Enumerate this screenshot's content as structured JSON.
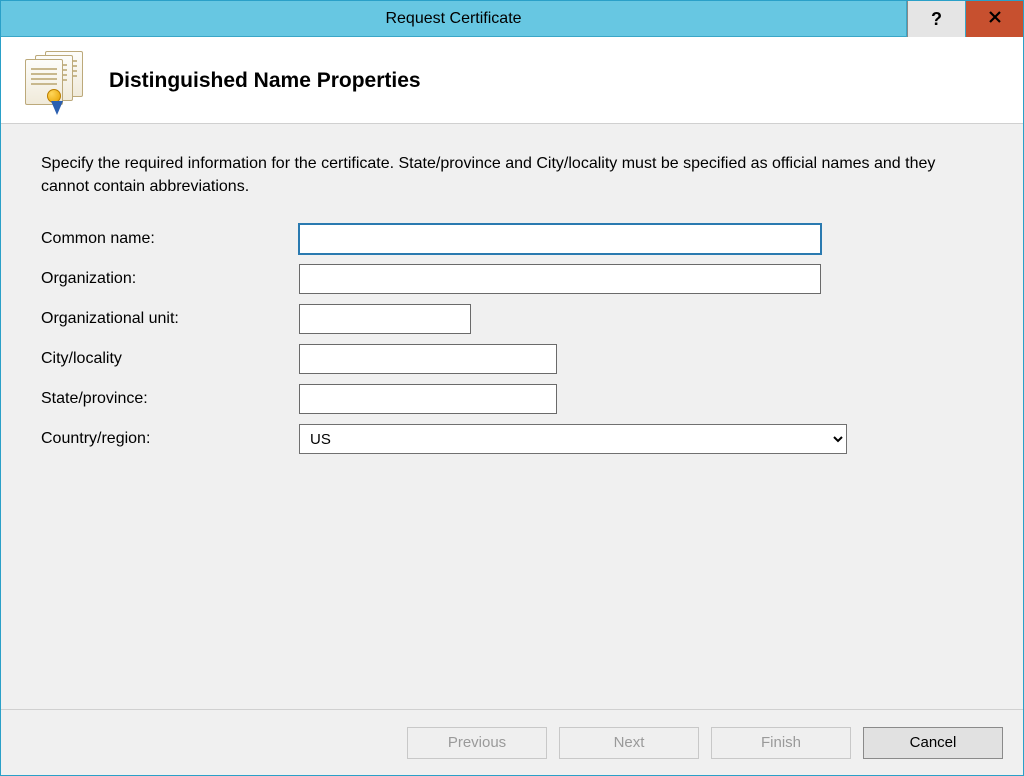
{
  "window": {
    "title": "Request Certificate"
  },
  "header": {
    "title": "Distinguished Name Properties"
  },
  "description": "Specify the required information for the certificate. State/province and City/locality must be specified as official names and they cannot contain abbreviations.",
  "form": {
    "common_name": {
      "label": "Common name:",
      "value": ""
    },
    "organization": {
      "label": "Organization:",
      "value": ""
    },
    "organizational_unit": {
      "label": "Organizational unit:",
      "value": ""
    },
    "city_locality": {
      "label": "City/locality",
      "value": ""
    },
    "state_province": {
      "label": "State/province:",
      "value": ""
    },
    "country_region": {
      "label": "Country/region:",
      "value": "US"
    }
  },
  "buttons": {
    "previous": "Previous",
    "next": "Next",
    "finish": "Finish",
    "cancel": "Cancel"
  }
}
